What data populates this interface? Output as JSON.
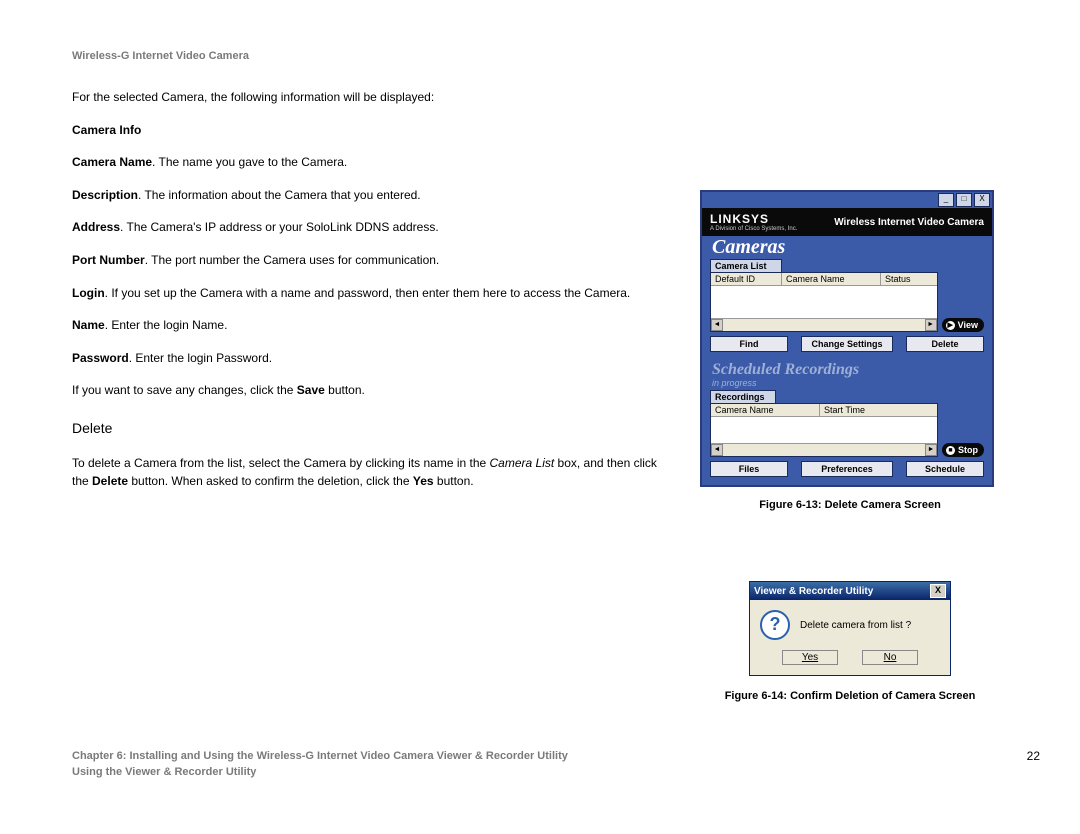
{
  "header": {
    "title": "Wireless-G Internet Video Camera"
  },
  "body": {
    "intro": "For the selected Camera, the following information will be displayed:",
    "cameraInfoHeading": "Camera Info",
    "items": {
      "cameraName": {
        "label": "Camera Name",
        "text": ". The name you gave to the Camera."
      },
      "description": {
        "label": "Description",
        "text": ". The information about the Camera that you entered."
      },
      "address": {
        "label": "Address",
        "text": ". The Camera's IP address or your SoloLink DDNS address."
      },
      "portNumber": {
        "label": "Port Number",
        "text": ". The port number the Camera uses for communication."
      },
      "login": {
        "label": "Login",
        "text": ". If you set up the Camera with a name and password, then enter them here to access the Camera."
      },
      "name": {
        "label": "Name",
        "text": ". Enter the login Name."
      },
      "password": {
        "label": "Password",
        "text": ". Enter the login Password."
      }
    },
    "savePre": "If you want to save any changes, click the ",
    "saveBold": "Save",
    "savePost": " button.",
    "deleteHeading": "Delete",
    "deletePara": {
      "p1": "To delete a Camera from the list, select the Camera by clicking its name in the ",
      "italic": "Camera List",
      "p2": " box, and then click the ",
      "bold1": "Delete",
      "p3": " button. When asked to confirm the deletion, click the ",
      "bold2": "Yes",
      "p4": " button."
    }
  },
  "app": {
    "brand": "LINKSYS",
    "brandSub": "A Division of Cisco Systems, Inc.",
    "product": "Wireless Internet Video Camera",
    "camerasTitle": "Cameras",
    "cameraListLabel": "Camera List",
    "cols": {
      "c1": "Default ID",
      "c2": "Camera Name",
      "c3": "Status"
    },
    "btns": {
      "find": "Find",
      "change": "Change Settings",
      "del": "Delete",
      "view": "View"
    },
    "schedTitle": "Scheduled Recordings",
    "schedSub": "in progress",
    "recLabel": "Recordings",
    "recCols": {
      "c1": "Camera Name",
      "c2": "Start Time"
    },
    "btns2": {
      "files": "Files",
      "prefs": "Preferences",
      "sched": "Schedule",
      "stop": "Stop"
    },
    "winbtns": {
      "min": "_",
      "max": "□",
      "close": "X"
    }
  },
  "figcaps": {
    "f13": "Figure 6-13: Delete Camera Screen",
    "f14": "Figure 6-14: Confirm Deletion of Camera Screen"
  },
  "dialog": {
    "title": "Viewer & Recorder Utility",
    "msg": "Delete camera from list ?",
    "yes": "Yes",
    "no": "No"
  },
  "footer": {
    "line1": "Chapter 6: Installing and Using the Wireless-G Internet Video Camera Viewer & Recorder Utility",
    "line2": "Using the Viewer & Recorder Utility",
    "page": "22"
  }
}
